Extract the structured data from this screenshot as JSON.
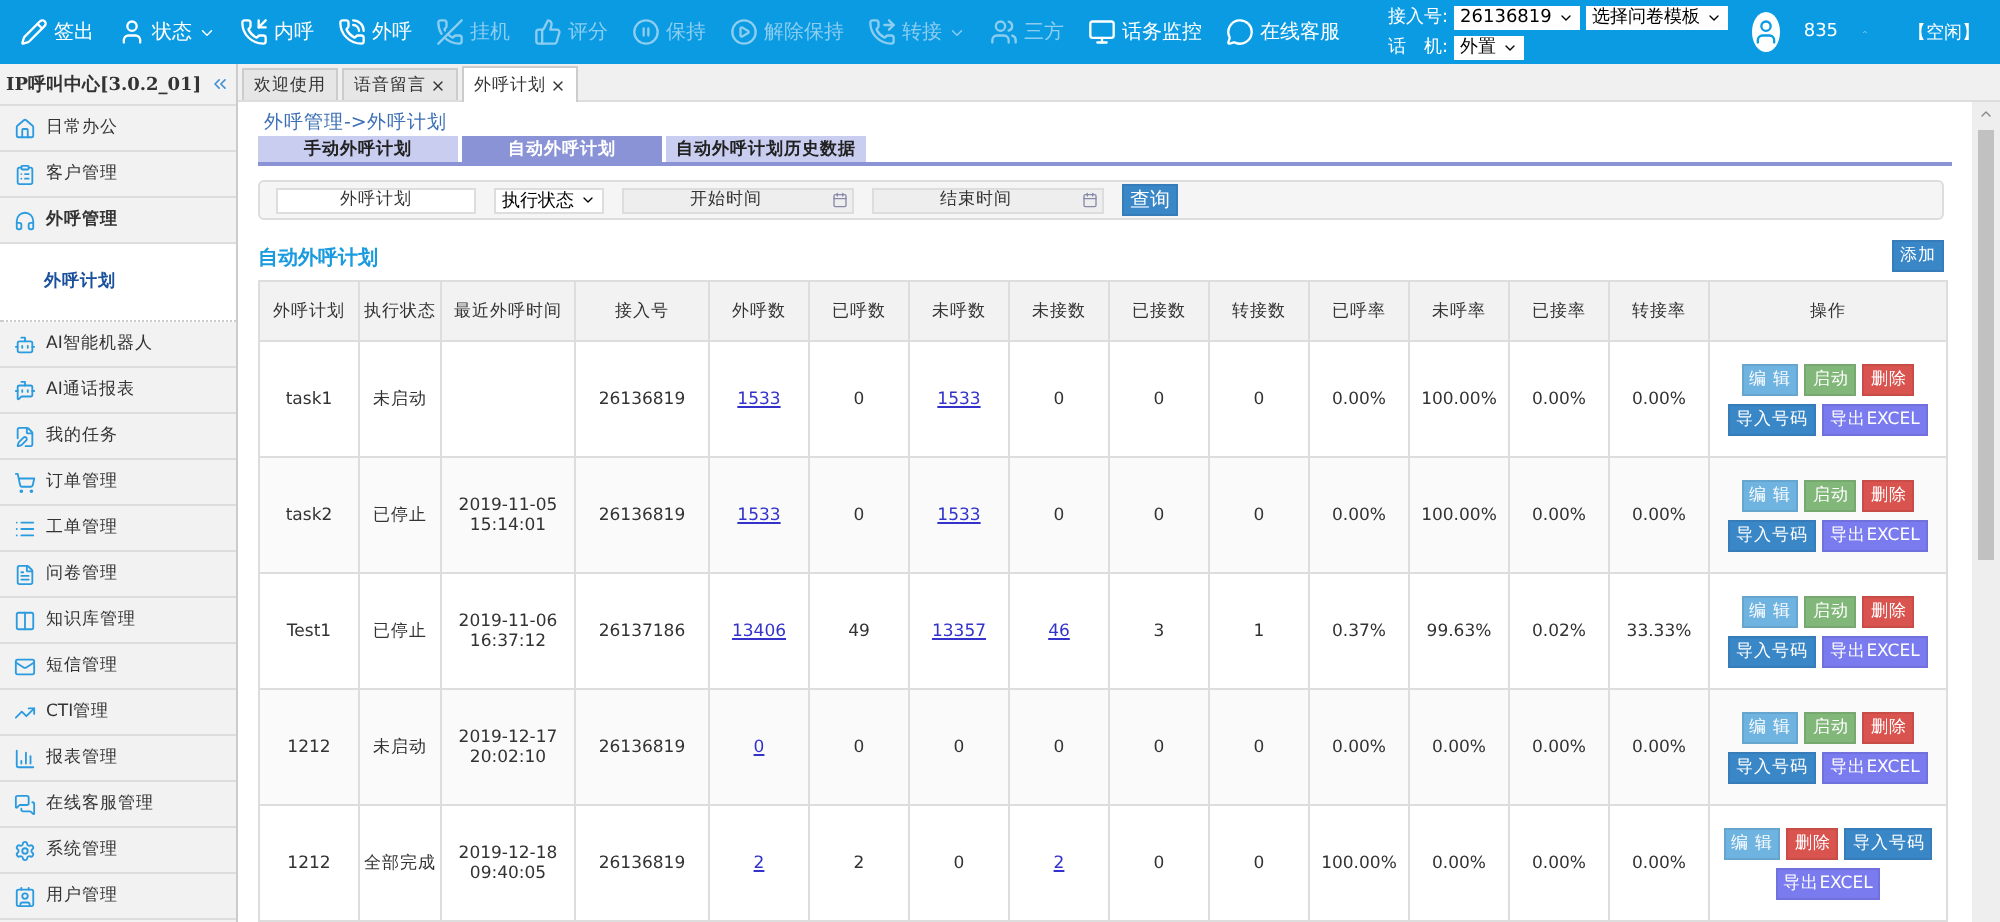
{
  "toolbar": {
    "items": [
      {
        "label": "签出",
        "disabled": false,
        "dropdown": false
      },
      {
        "label": "状态",
        "disabled": false,
        "dropdown": true
      },
      {
        "label": "内呼",
        "disabled": false,
        "dropdown": false
      },
      {
        "label": "外呼",
        "disabled": false,
        "dropdown": false
      },
      {
        "label": "挂机",
        "disabled": true,
        "dropdown": false
      },
      {
        "label": "评分",
        "disabled": true,
        "dropdown": false
      },
      {
        "label": "保持",
        "disabled": true,
        "dropdown": false
      },
      {
        "label": "解除保持",
        "disabled": true,
        "dropdown": false
      },
      {
        "label": "转接",
        "disabled": true,
        "dropdown": true
      },
      {
        "label": "三方",
        "disabled": true,
        "dropdown": false
      },
      {
        "label": "话务监控",
        "disabled": false,
        "dropdown": false
      },
      {
        "label": "在线客服",
        "disabled": false,
        "dropdown": false
      }
    ],
    "access_label": "接入号:",
    "access_value": "26136819",
    "template_value": "选择问卷模板",
    "phone_label": "话　机:",
    "phone_value": "外置",
    "user": "835",
    "status": "【空闲】"
  },
  "sidebar": {
    "title": "IP呼叫中心[3.0.2_01]",
    "items": [
      {
        "label": "日常办公",
        "expanded": false
      },
      {
        "label": "客户管理",
        "expanded": false
      },
      {
        "label": "外呼管理",
        "expanded": true,
        "children": [
          {
            "label": "外呼计划",
            "selected": true
          }
        ]
      },
      {
        "label": "AI智能机器人",
        "expanded": false
      },
      {
        "label": "AI通话报表",
        "expanded": false
      },
      {
        "label": "我的任务",
        "expanded": false
      },
      {
        "label": "订单管理",
        "expanded": false
      },
      {
        "label": "工单管理",
        "expanded": false
      },
      {
        "label": "问卷管理",
        "expanded": false
      },
      {
        "label": "知识库管理",
        "expanded": false
      },
      {
        "label": "短信管理",
        "expanded": false
      },
      {
        "label": "CTI管理",
        "expanded": false
      },
      {
        "label": "报表管理",
        "expanded": false
      },
      {
        "label": "在线客服管理",
        "expanded": false
      },
      {
        "label": "系统管理",
        "expanded": false
      },
      {
        "label": "用户管理",
        "expanded": false
      }
    ]
  },
  "page_tabs": [
    {
      "label": "欢迎使用",
      "selected": false,
      "closable": false
    },
    {
      "label": "语音留言",
      "selected": false,
      "closable": true
    },
    {
      "label": "外呼计划",
      "selected": true,
      "closable": true
    }
  ],
  "breadcrumb": "外呼管理->外呼计划",
  "sub_tabs": [
    {
      "label": "手动外呼计划",
      "selected": false
    },
    {
      "label": "自动外呼计划",
      "selected": true
    },
    {
      "label": "自动外呼计划历史数据",
      "selected": false
    }
  ],
  "filter": {
    "plan_placeholder": "外呼计划",
    "status_value": "执行状态",
    "start_placeholder": "开始时间",
    "end_placeholder": "结束时间",
    "search_button": "查询"
  },
  "section_title": "自动外呼计划",
  "add_button": "添加",
  "table": {
    "columns": [
      "外呼计划",
      "执行状态",
      "最近外呼时间",
      "接入号",
      "外呼数",
      "已呼数",
      "未呼数",
      "未接数",
      "已接数",
      "转接数",
      "已呼率",
      "未呼率",
      "已接率",
      "转接率",
      "操作"
    ],
    "rows": [
      {
        "cells": [
          "task1",
          "未启动",
          null,
          "26136819",
          {
            "text": "1533",
            "link": true
          },
          "0",
          {
            "text": "1533",
            "link": true
          },
          "0",
          "0",
          "0",
          "0.00%",
          "100.00%",
          "0.00%",
          "0.00%"
        ],
        "actions": [
          {
            "kind": "edit",
            "label": "编 辑"
          },
          {
            "kind": "start",
            "label": "启动"
          },
          {
            "kind": "delete",
            "label": "删除"
          },
          {
            "kind": "import",
            "label": "导入号码"
          },
          {
            "kind": "export",
            "label": "导出EXCEL"
          }
        ]
      },
      {
        "cells": [
          "task2",
          "已停止",
          "2019-11-05 15:14:01",
          "26136819",
          {
            "text": "1533",
            "link": true
          },
          "0",
          {
            "text": "1533",
            "link": true
          },
          "0",
          "0",
          "0",
          "0.00%",
          "100.00%",
          "0.00%",
          "0.00%"
        ],
        "actions": [
          {
            "kind": "edit",
            "label": "编 辑"
          },
          {
            "kind": "start",
            "label": "启动"
          },
          {
            "kind": "delete",
            "label": "删除"
          },
          {
            "kind": "import",
            "label": "导入号码"
          },
          {
            "kind": "export",
            "label": "导出EXCEL"
          }
        ]
      },
      {
        "cells": [
          "Test1",
          "已停止",
          "2019-11-06 16:37:12",
          "26137186",
          {
            "text": "13406",
            "link": true
          },
          "49",
          {
            "text": "13357",
            "link": true
          },
          {
            "text": "46",
            "link": true
          },
          "3",
          "1",
          "0.37%",
          "99.63%",
          "0.02%",
          "33.33%"
        ],
        "actions": [
          {
            "kind": "edit",
            "label": "编 辑"
          },
          {
            "kind": "start",
            "label": "启动"
          },
          {
            "kind": "delete",
            "label": "删除"
          },
          {
            "kind": "import",
            "label": "导入号码"
          },
          {
            "kind": "export",
            "label": "导出EXCEL"
          }
        ]
      },
      {
        "cells": [
          "1212",
          "未启动",
          "2019-12-17 20:02:10",
          "26136819",
          {
            "text": "0",
            "link": true
          },
          "0",
          "0",
          "0",
          "0",
          "0",
          "0.00%",
          "0.00%",
          "0.00%",
          "0.00%"
        ],
        "actions": [
          {
            "kind": "edit",
            "label": "编 辑"
          },
          {
            "kind": "start",
            "label": "启动"
          },
          {
            "kind": "delete",
            "label": "删除"
          },
          {
            "kind": "import",
            "label": "导入号码"
          },
          {
            "kind": "export",
            "label": "导出EXCEL"
          }
        ]
      },
      {
        "cells": [
          "1212",
          "全部完成",
          "2019-12-18 09:40:05",
          "26136819",
          {
            "text": "2",
            "link": true
          },
          "2",
          "0",
          {
            "text": "2",
            "link": true
          },
          "0",
          "0",
          "100.00%",
          "0.00%",
          "0.00%",
          "0.00%"
        ],
        "actions": [
          {
            "kind": "edit",
            "label": "编 辑"
          },
          {
            "kind": "delete",
            "label": "删除"
          },
          {
            "kind": "import",
            "label": "导入号码"
          },
          {
            "kind": "export",
            "label": "导出EXCEL"
          }
        ]
      }
    ]
  }
}
